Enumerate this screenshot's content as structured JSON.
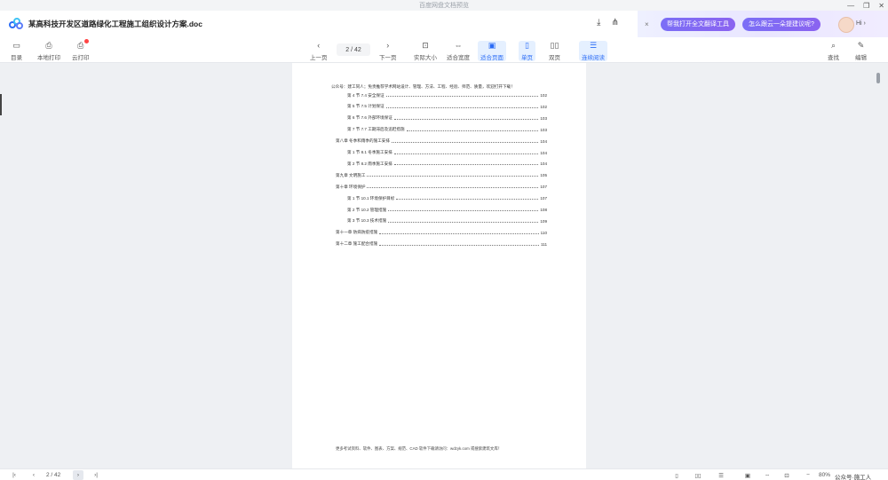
{
  "window": {
    "title": "百度网盘文档预览",
    "controls": [
      "—",
      "❐",
      "✕"
    ]
  },
  "header": {
    "doc_title": "某高科技开发区道路绿化工程施工组织设计方案.doc",
    "ai": {
      "close": "×",
      "btn1": "帮我打开全文翻译工具",
      "btn2": "怎么跟云一朵提建议呢?",
      "hi": "Hi ›"
    }
  },
  "toolbar": {
    "left": [
      "目录",
      "本地打印",
      "云打印"
    ],
    "prev": "上一页",
    "page_indicator": "2 / 42",
    "next": "下一页",
    "view": [
      "实际大小",
      "适合宽度",
      "适合页面",
      "单页",
      "双页",
      "连续阅读"
    ],
    "right": [
      "查找",
      "编辑"
    ]
  },
  "doc": {
    "header_line": "公众号：建工同人；免责推荐学术网站设计、管理、方法、工程、经验、师范、质量，欢迎打开下载！",
    "toc": [
      {
        "level": 2,
        "title": "第 4 节  7.4 安全保证",
        "page": "102"
      },
      {
        "level": 2,
        "title": "第 5 节  7.5 计划保证",
        "page": "102"
      },
      {
        "level": 2,
        "title": "第 6 节  7.6 外部环境保证",
        "page": "103"
      },
      {
        "level": 2,
        "title": "第 7 节  7.7 工期滞后及追赶措施",
        "page": "103"
      },
      {
        "level": 1,
        "title": "第八章  冬季和雨季的施工安排",
        "page": "104"
      },
      {
        "level": 2,
        "title": "第 1 节  8.1 冬季施工安排",
        "page": "104"
      },
      {
        "level": 2,
        "title": "第 2 节  8.2 雨季施工安排",
        "page": "104"
      },
      {
        "level": 1,
        "title": "第九章  文明施工",
        "page": "105"
      },
      {
        "level": 1,
        "title": "第十章  环境保护",
        "page": "107"
      },
      {
        "level": 2,
        "title": "第 1 节  10.1 环境保护目标",
        "page": "107"
      },
      {
        "level": 2,
        "title": "第 2 节  10.2 管理措施",
        "page": "108"
      },
      {
        "level": 2,
        "title": "第 3 节  10.3 技术措施",
        "page": "109"
      },
      {
        "level": 1,
        "title": "第十一章  防病防疫措施",
        "page": "110"
      },
      {
        "level": 1,
        "title": "第十二章  施工配合措施",
        "page": "111"
      }
    ],
    "footer": "更多考试资料、软件、图表、方案、规范、CAD 软件下载请访问：wdzyk.com 或搜索建筑文库！"
  },
  "statusbar": {
    "page_indicator": "2 / 42",
    "zoom": "80%",
    "watermark": "公众号·施工人"
  }
}
